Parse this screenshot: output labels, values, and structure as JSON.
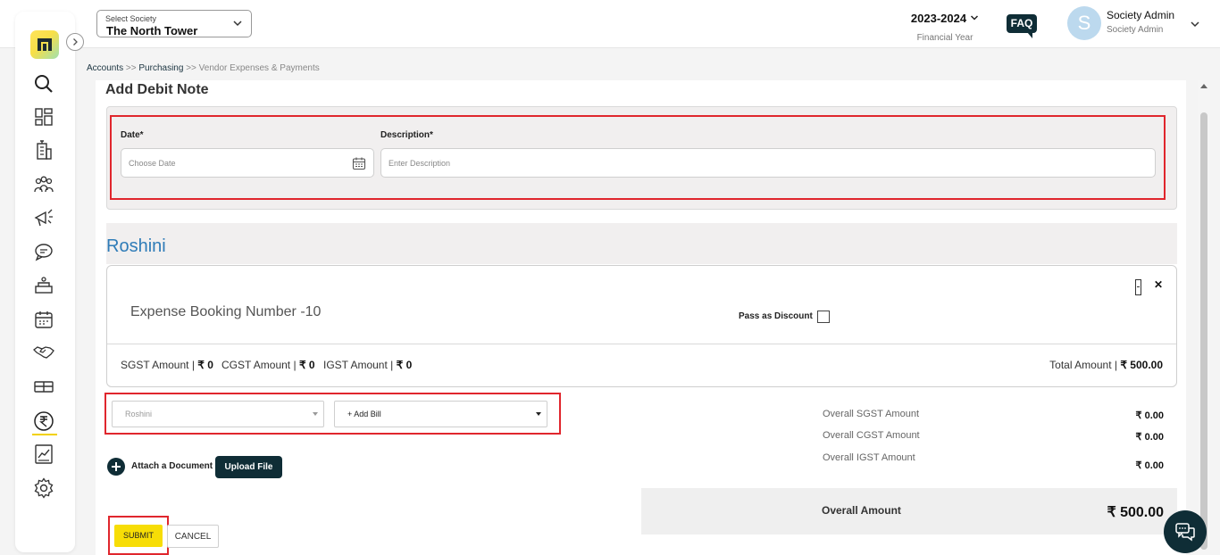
{
  "header": {
    "society_label": "Select Society",
    "society_value": "The North Tower",
    "financial_year": "2023-2024",
    "financial_year_label": "Financial Year",
    "faq_label": "FAQ",
    "avatar_initial": "S",
    "user_name": "Society Admin",
    "user_role": "Society Admin"
  },
  "sidebar": {
    "icons": [
      "logo-icon",
      "search-icon",
      "dashboard-icon",
      "building-icon",
      "members-icon",
      "announcement-icon",
      "chat-icon",
      "services-icon",
      "calendar-icon",
      "handshake-icon",
      "parking-icon",
      "accounts-rupee-icon",
      "reports-chart-icon",
      "settings-gear-icon"
    ],
    "active_icon": "accounts-rupee-icon",
    "accent_color": "#f2d100"
  },
  "breadcrumb": {
    "item1": "Accounts",
    "sep": ">>",
    "item2": "Purchasing",
    "item3": "Vendor Expenses & Payments"
  },
  "form": {
    "title": "Add Debit Note",
    "date_label": "Date*",
    "date_placeholder": "Choose Date",
    "description_label": "Description*",
    "description_placeholder": "Enter Description"
  },
  "vendor": {
    "name": "Roshini",
    "booking_title": "Expense Booking Number -10",
    "pass_discount_label": "Pass as Discount",
    "sgst_label": "SGST Amount |",
    "sgst_value": "₹ 0",
    "cgst_label": "CGST Amount |",
    "cgst_value": "₹ 0",
    "igst_label": "IGST Amount |",
    "igst_value": "₹ 0",
    "total_label": "Total Amount |",
    "total_value": "₹ 500.00"
  },
  "bill_select": {
    "vendor_value": "Roshini",
    "add_bill_label": "+ Add Bill"
  },
  "summary": {
    "overall_sgst_label": "Overall SGST Amount",
    "overall_sgst_value": "₹ 0.00",
    "overall_cgst_label": "Overall CGST Amount",
    "overall_cgst_value": "₹ 0.00",
    "overall_igst_label": "Overall IGST Amount",
    "overall_igst_value": "₹ 0.00",
    "overall_label": "Overall Amount",
    "overall_value": "₹ 500.00"
  },
  "attachments": {
    "attach_label": "Attach a Document",
    "upload_label": "Upload File"
  },
  "actions": {
    "submit_label": "SUBMIT",
    "cancel_label": "CANCEL"
  },
  "colors": {
    "brand_dark": "#0f2d36",
    "submit_yellow": "#f7dd06",
    "highlight_red": "#e0262d",
    "vendor_blue": "#2f7cb8"
  }
}
